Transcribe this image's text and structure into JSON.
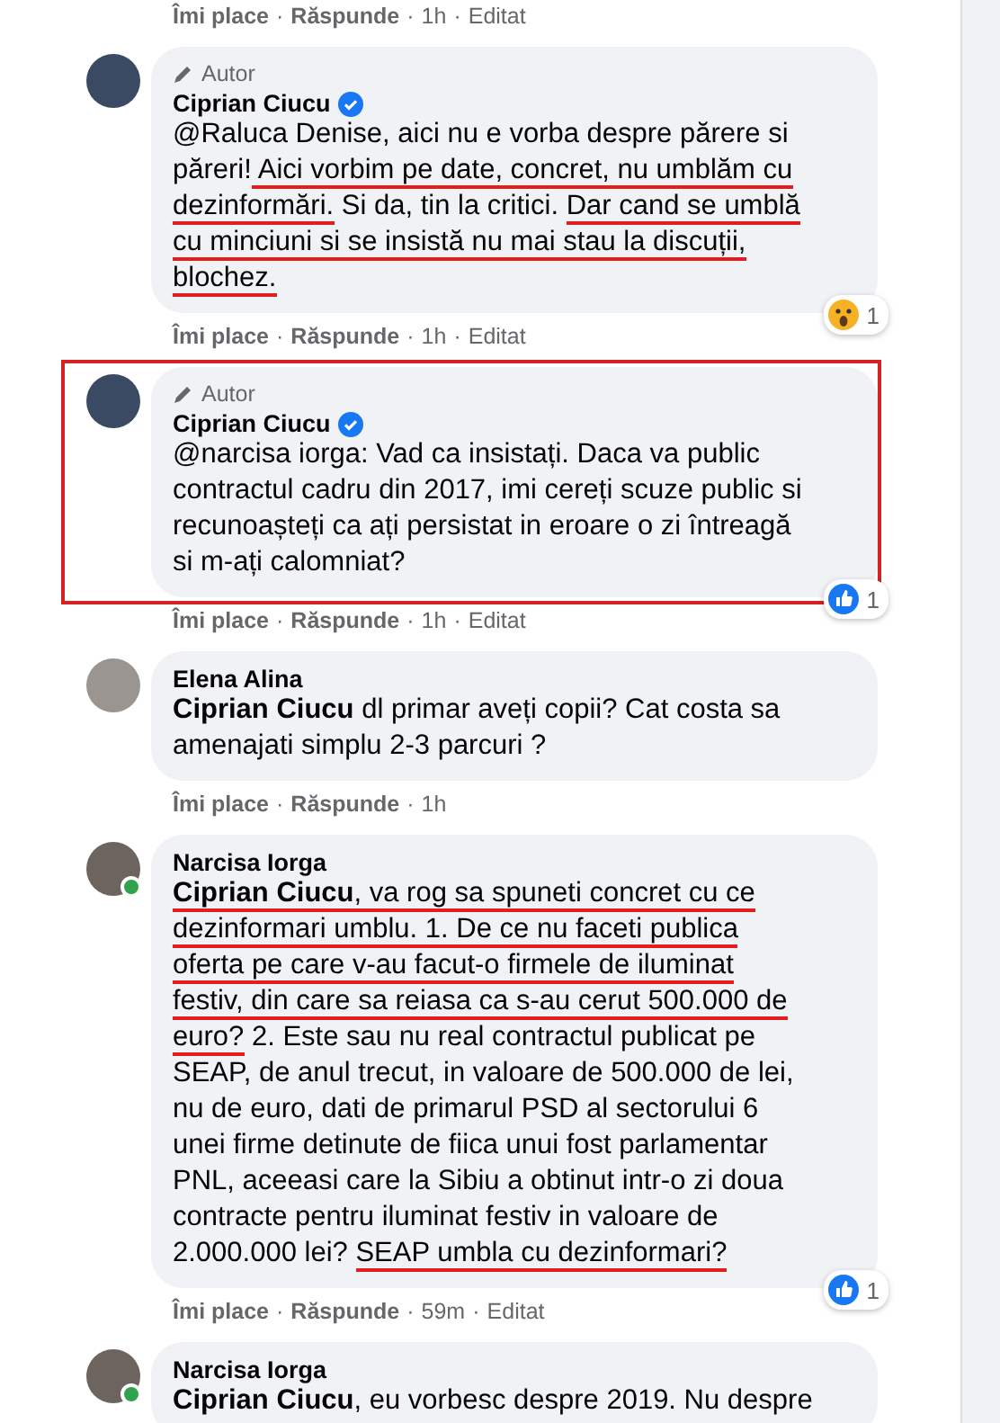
{
  "separator": "·",
  "top_actions": {
    "like": "Îmi place",
    "reply": "Răspunde",
    "time": "1h",
    "edited": "Editat"
  },
  "comments": [
    {
      "author": "Ciprian Ciucu",
      "badge": "Autor",
      "verified": true,
      "online": false,
      "highlighted": false,
      "lines": [
        [
          {
            "kind": "text",
            "text": "@Raluca Denise, aici nu e vorba despre părere si",
            "underline": false
          }
        ],
        [
          {
            "kind": "text",
            "text": "păreri!",
            "underline": false
          },
          {
            "kind": "text",
            "text": " Aici vorbim pe date, concret, nu umblăm cu",
            "underline": true
          }
        ],
        [
          {
            "kind": "text",
            "text": "dezinformări.",
            "underline": true
          },
          {
            "kind": "text",
            "text": " Si da, tin la critici. ",
            "underline": false
          },
          {
            "kind": "text",
            "text": "Dar cand se umblă",
            "underline": true
          }
        ],
        [
          {
            "kind": "text",
            "text": "cu minciuni si se insistă nu mai stau la discuții,",
            "underline": true
          }
        ],
        [
          {
            "kind": "text",
            "text": "blochez.",
            "underline": true
          }
        ]
      ],
      "actions": {
        "like": "Îmi place",
        "reply": "Răspunde",
        "time": "1h",
        "edited": "Editat"
      },
      "reaction": {
        "kind": "wow",
        "count": "1"
      }
    },
    {
      "author": "Ciprian Ciucu",
      "badge": "Autor",
      "verified": true,
      "online": false,
      "highlighted": true,
      "lines": [
        [
          {
            "kind": "text",
            "text": "@narcisa iorga: Vad ca insistați. Daca va public",
            "underline": false
          }
        ],
        [
          {
            "kind": "text",
            "text": "contractul cadru din 2017, imi cereți scuze public si",
            "underline": false
          }
        ],
        [
          {
            "kind": "text",
            "text": "recunoașteți ca ați persistat in eroare o zi întreagă",
            "underline": false
          }
        ],
        [
          {
            "kind": "text",
            "text": "si m-ați calomniat?",
            "underline": false
          }
        ]
      ],
      "actions": {
        "like": "Îmi place",
        "reply": "Răspunde",
        "time": "1h",
        "edited": "Editat"
      },
      "reaction": {
        "kind": "like",
        "count": "1"
      }
    },
    {
      "author": "Elena Alina",
      "verified": false,
      "online": false,
      "highlighted": false,
      "lines": [
        [
          {
            "kind": "mention",
            "text": "Ciprian Ciucu",
            "underline": false
          },
          {
            "kind": "text",
            "text": " dl primar aveți copii? Cat costa sa",
            "underline": false
          }
        ],
        [
          {
            "kind": "text",
            "text": "amenajati simplu 2-3 parcuri ?",
            "underline": false
          }
        ]
      ],
      "actions": {
        "like": "Îmi place",
        "reply": "Răspunde",
        "time": "1h"
      }
    },
    {
      "author": "Narcisa Iorga",
      "verified": false,
      "online": true,
      "highlighted": false,
      "lines": [
        [
          {
            "kind": "mention",
            "text": "Ciprian Ciucu",
            "underline": true
          },
          {
            "kind": "text",
            "text": ", va rog sa spuneti concret cu ce",
            "underline": true
          }
        ],
        [
          {
            "kind": "text",
            "text": "dezinformari umblu. 1. De ce nu faceti publica",
            "underline": true
          }
        ],
        [
          {
            "kind": "text",
            "text": "oferta pe care v-au facut-o firmele de iluminat",
            "underline": true
          }
        ],
        [
          {
            "kind": "text",
            "text": "festiv, din care sa reiasa ca s-au cerut 500.000 de",
            "underline": true
          }
        ],
        [
          {
            "kind": "text",
            "text": "euro?",
            "underline": true
          },
          {
            "kind": "text",
            "text": " 2. Este sau nu real contractul publicat pe",
            "underline": false
          }
        ],
        [
          {
            "kind": "text",
            "text": "SEAP, de anul trecut, in valoare de 500.000 de lei,",
            "underline": false
          }
        ],
        [
          {
            "kind": "text",
            "text": "nu de euro, dati de primarul PSD al sectorului 6",
            "underline": false
          }
        ],
        [
          {
            "kind": "text",
            "text": "unei firme detinute de fiica unui fost parlamentar",
            "underline": false
          }
        ],
        [
          {
            "kind": "text",
            "text": "PNL, aceeasi care la Sibiu a obtinut intr-o zi doua",
            "underline": false
          }
        ],
        [
          {
            "kind": "text",
            "text": "contracte pentru iluminat festiv in valoare de",
            "underline": false
          }
        ],
        [
          {
            "kind": "text",
            "text": "2.000.000 lei? ",
            "underline": false
          },
          {
            "kind": "text",
            "text": "SEAP umbla cu dezinformari?",
            "underline": true
          }
        ]
      ],
      "actions": {
        "like": "Îmi place",
        "reply": "Răspunde",
        "time": "59m",
        "edited": "Editat"
      },
      "reaction": {
        "kind": "like",
        "count": "1"
      }
    },
    {
      "author": "Narcisa Iorga",
      "verified": false,
      "online": true,
      "highlighted": false,
      "lines": [
        [
          {
            "kind": "mention",
            "text": "Ciprian Ciucu",
            "underline": false
          },
          {
            "kind": "text",
            "text": ", eu vorbesc despre 2019. Nu despre",
            "underline": false
          }
        ]
      ]
    }
  ]
}
